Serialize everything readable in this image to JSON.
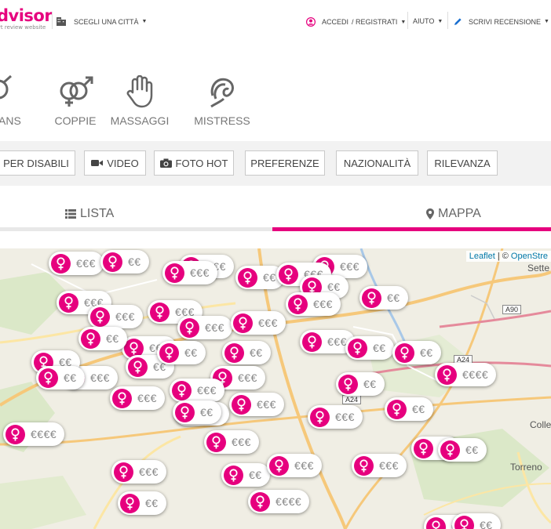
{
  "header": {
    "logo_text": "dvisor",
    "logo_sub": "rt review website",
    "city_select": "SCEGLI UNA CITTÀ",
    "login": "ACCEDI",
    "register": "/ REGISTRATI",
    "help": "AIUTO",
    "write_review": "SCRIVI RECENSIONE"
  },
  "categories": [
    {
      "label": "ANS",
      "icon": "trans-icon"
    },
    {
      "label": "COPPIE",
      "icon": "couple-icon"
    },
    {
      "label": "MASSAGGI",
      "icon": "massage-hand-icon"
    },
    {
      "label": "MISTRESS",
      "icon": "mistress-icon"
    }
  ],
  "filters": [
    {
      "label": "PER DISABILI"
    },
    {
      "label": "VIDEO",
      "icon": "video-icon"
    },
    {
      "label": "FOTO HOT",
      "icon": "camera-icon"
    },
    {
      "label": "PREFERENZE"
    },
    {
      "label": "NAZIONALITÀ"
    },
    {
      "label": "RILEVANZA"
    }
  ],
  "tabs": {
    "list": "LISTA",
    "map": "MAPPA",
    "active": "map"
  },
  "map": {
    "attribution_link": "Leaflet",
    "attribution_sep": " | © ",
    "attribution_osm": "OpenStre",
    "places": [
      "Sette",
      "Colle",
      "Torreno"
    ],
    "roads": [
      "A90",
      "A24",
      "A24"
    ],
    "markers": [
      {
        "type": "female",
        "price": "€€€"
      },
      {
        "type": "female",
        "price": "€€"
      },
      {
        "type": "female",
        "price": "€€€"
      },
      {
        "type": "female",
        "price": "€€€"
      },
      {
        "type": "female",
        "price": "€€"
      },
      {
        "type": "female",
        "price": "€€€"
      },
      {
        "type": "female",
        "price": "€€€"
      },
      {
        "type": "female",
        "price": "€€"
      },
      {
        "type": "female",
        "price": "€€"
      },
      {
        "type": "female",
        "price": "€€€"
      },
      {
        "type": "female",
        "price": "€€€"
      },
      {
        "type": "female",
        "price": "€€€"
      },
      {
        "type": "female",
        "price": "€€€"
      },
      {
        "type": "female",
        "price": "€€€"
      },
      {
        "type": "female",
        "price": "€€€"
      },
      {
        "type": "female",
        "price": "€€€"
      },
      {
        "type": "female",
        "price": "€€"
      },
      {
        "type": "female",
        "price": "€€€"
      },
      {
        "type": "female",
        "price": "€€€€"
      },
      {
        "type": "female",
        "price": "€€"
      },
      {
        "type": "female",
        "price": "€€"
      },
      {
        "type": "female",
        "price": "€€€"
      },
      {
        "type": "female",
        "price": "€€"
      },
      {
        "type": "female",
        "price": "€€€"
      },
      {
        "type": "female",
        "price": "€€€€"
      },
      {
        "type": "female",
        "price": "€€€"
      },
      {
        "type": "female",
        "price": "€€€"
      },
      {
        "type": "female",
        "price": "€€€"
      },
      {
        "type": "female",
        "price": "€€€"
      },
      {
        "type": "female",
        "price": "€€"
      },
      {
        "type": "female",
        "price": "€€€"
      },
      {
        "type": "female",
        "price": "€€€"
      },
      {
        "type": "female",
        "price": "€€€€"
      },
      {
        "type": "female",
        "price": "€€"
      },
      {
        "type": "female",
        "price": "€€"
      },
      {
        "type": "female",
        "price": "€€"
      },
      {
        "type": "female",
        "price": "€€€"
      },
      {
        "type": "female",
        "price": "€€€"
      },
      {
        "type": "female",
        "price": "€€"
      },
      {
        "type": "female",
        "price": "€€"
      },
      {
        "type": "female",
        "price": "€€"
      },
      {
        "type": "female",
        "price": "€€"
      },
      {
        "type": "female",
        "price": "€€"
      },
      {
        "type": "female",
        "price": "€€"
      },
      {
        "type": "female",
        "price": "€€"
      },
      {
        "type": "female",
        "price": "€€"
      },
      {
        "type": "female",
        "price": "€€"
      },
      {
        "type": "female",
        "price": "€€€"
      }
    ]
  }
}
